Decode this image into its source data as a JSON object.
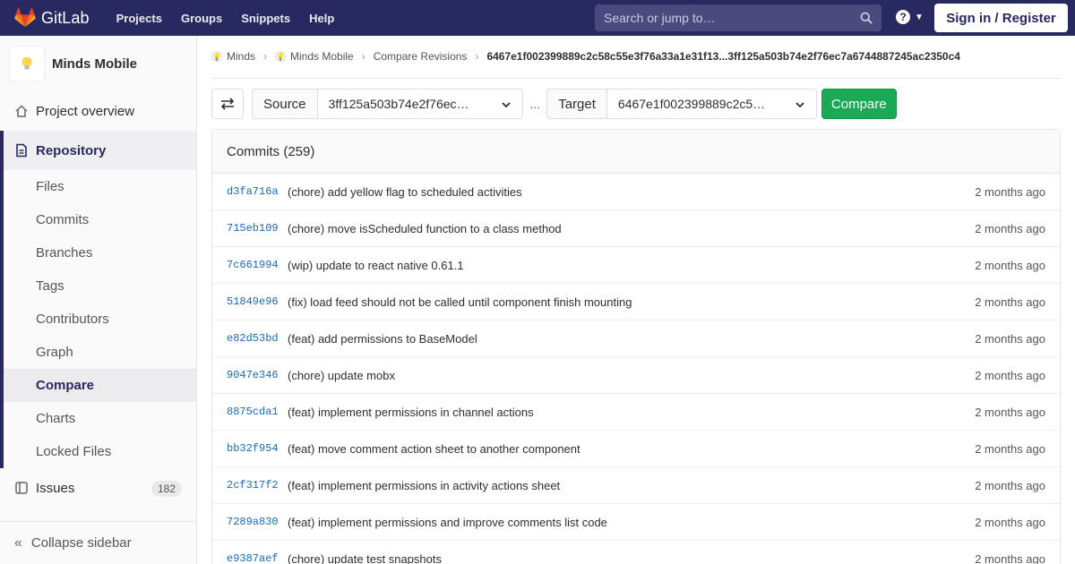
{
  "navbar": {
    "brand": "GitLab",
    "links": [
      "Projects",
      "Groups",
      "Snippets",
      "Help"
    ],
    "search_placeholder": "Search or jump to…",
    "help_icon": "?",
    "signin_label": "Sign in / Register",
    "bg_color": "#292961"
  },
  "sidebar": {
    "project_name": "Minds Mobile",
    "project_overview": "Project overview",
    "repository": "Repository",
    "repo_items": [
      "Files",
      "Commits",
      "Branches",
      "Tags",
      "Contributors",
      "Graph",
      "Compare",
      "Charts",
      "Locked Files"
    ],
    "active_item": "Compare",
    "issues_label": "Issues",
    "issues_count": "182",
    "collapse_label": "Collapse sidebar"
  },
  "breadcrumb": {
    "items": [
      "Minds",
      "Minds Mobile",
      "Compare Revisions"
    ],
    "current": "6467e1f002399889c2c58c55e3f76a33a1e31f13...3ff125a503b74e2f76ec7a6744887245ac2350c4"
  },
  "compare": {
    "source_label": "Source",
    "source_value": "3ff125a503b74e2f76ec…",
    "separator": "...",
    "target_label": "Target",
    "target_value": "6467e1f002399889c2c5…",
    "compare_button": "Compare",
    "compare_color": "#1aaa55"
  },
  "commits": {
    "header": "Commits (259)",
    "rows": [
      {
        "sha": "d3fa716a",
        "message": "(chore) add yellow flag to scheduled activities",
        "time": "2 months ago"
      },
      {
        "sha": "715eb109",
        "message": "(chore) move isScheduled function to a class method",
        "time": "2 months ago"
      },
      {
        "sha": "7c661994",
        "message": "(wip) update to react native 0.61.1",
        "time": "2 months ago"
      },
      {
        "sha": "51849e96",
        "message": "(fix) load feed should not be called until component finish mounting",
        "time": "2 months ago"
      },
      {
        "sha": "e82d53bd",
        "message": "(feat) add permissions to BaseModel",
        "time": "2 months ago"
      },
      {
        "sha": "9047e346",
        "message": "(chore) update mobx",
        "time": "2 months ago"
      },
      {
        "sha": "8875cda1",
        "message": "(feat) implement permissions in channel actions",
        "time": "2 months ago"
      },
      {
        "sha": "bb32f954",
        "message": "(feat) move comment action sheet to another component",
        "time": "2 months ago"
      },
      {
        "sha": "2cf317f2",
        "message": "(feat) implement permissions in activity actions sheet",
        "time": "2 months ago"
      },
      {
        "sha": "7289a830",
        "message": "(feat) implement permissions and improve comments list code",
        "time": "2 months ago"
      },
      {
        "sha": "e9387aef",
        "message": "(chore) update test snapshots",
        "time": "2 months ago"
      }
    ]
  }
}
